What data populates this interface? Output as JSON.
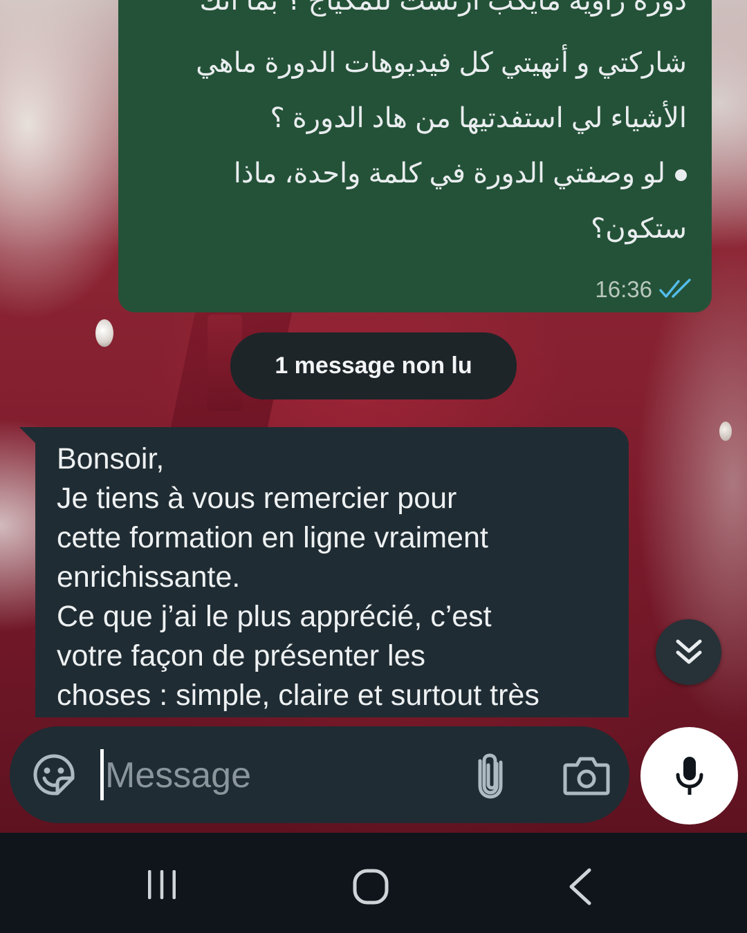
{
  "chat": {
    "outgoing": {
      "lines": [
        "دورة راوية مايكب أرتست للمكياج ؟ بما أنك",
        "شاركتي و أنهيتي كل فيديوهات الدورة ماهي",
        "الأشياء لي استفدتيها من هاد الدورة ؟",
        "لو وصفتي الدورة في كلمة واحدة، ماذا",
        "ستكون؟"
      ],
      "time": "16:36",
      "status_icon": "double-check-read-icon",
      "bubble_color": "#245238"
    },
    "unread_divider": "1 message non lu",
    "incoming": {
      "text": "Bonsoir,\nJe tiens à vous remercier pour\ncette formation en ligne vraiment\nenrichissante.\nCe que j’ai le plus apprécié, c’est\nvotre façon de présenter les\nchoses : simple, claire et surtout très",
      "bubble_color": "#202c33"
    }
  },
  "compose": {
    "placeholder": "Message",
    "icons": [
      "sticker-emoji-icon",
      "attach-paperclip-icon",
      "camera-icon",
      "microphone-icon"
    ]
  },
  "scroll_button_icon": "double-chevron-down-icon",
  "navbar": {
    "icons": [
      "recent-apps-icon",
      "home-icon",
      "back-icon"
    ]
  },
  "colors": {
    "read_tick": "#53bdeb",
    "nav_background": "#0f151b"
  }
}
